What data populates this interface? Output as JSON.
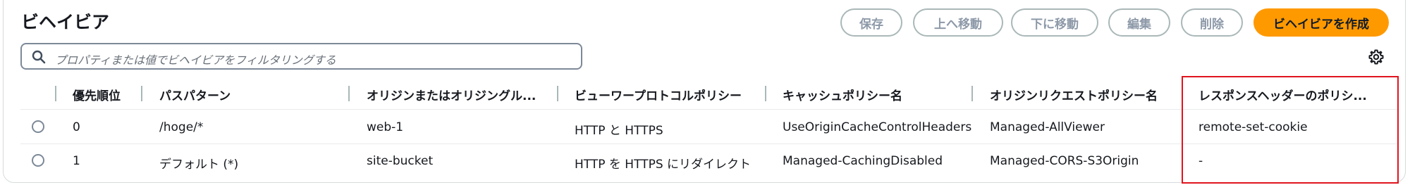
{
  "header": {
    "title": "ビヘイビア",
    "buttons": {
      "save": "保存",
      "move_up": "上へ移動",
      "move_down": "下に移動",
      "edit": "編集",
      "delete": "削除",
      "create": "ビヘイビアを作成"
    }
  },
  "search": {
    "placeholder": "プロパティまたは値でビヘイビアをフィルタリングする"
  },
  "table": {
    "columns": [
      "優先順位",
      "パスパターン",
      "オリジンまたはオリジングル...",
      "ビューワープロトコルポリシー",
      "キャッシュポリシー名",
      "オリジンリクエストポリシー名",
      "レスポンスヘッダーのポリシ..."
    ],
    "rows": [
      [
        "0",
        "/hoge/*",
        "web-1",
        "HTTP と HTTPS",
        "UseOriginCacheControlHeaders",
        "Managed-AllViewer",
        "remote-set-cookie"
      ],
      [
        "1",
        "デフォルト (*)",
        "site-bucket",
        "HTTP を HTTPS にリダイレクト",
        "Managed-CachingDisabled",
        "Managed-CORS-S3Origin",
        "-"
      ]
    ]
  },
  "icons": {
    "search": "search-icon",
    "settings": "gear-icon"
  },
  "colors": {
    "primary": "#ff9900",
    "highlight": "#e0141e"
  }
}
